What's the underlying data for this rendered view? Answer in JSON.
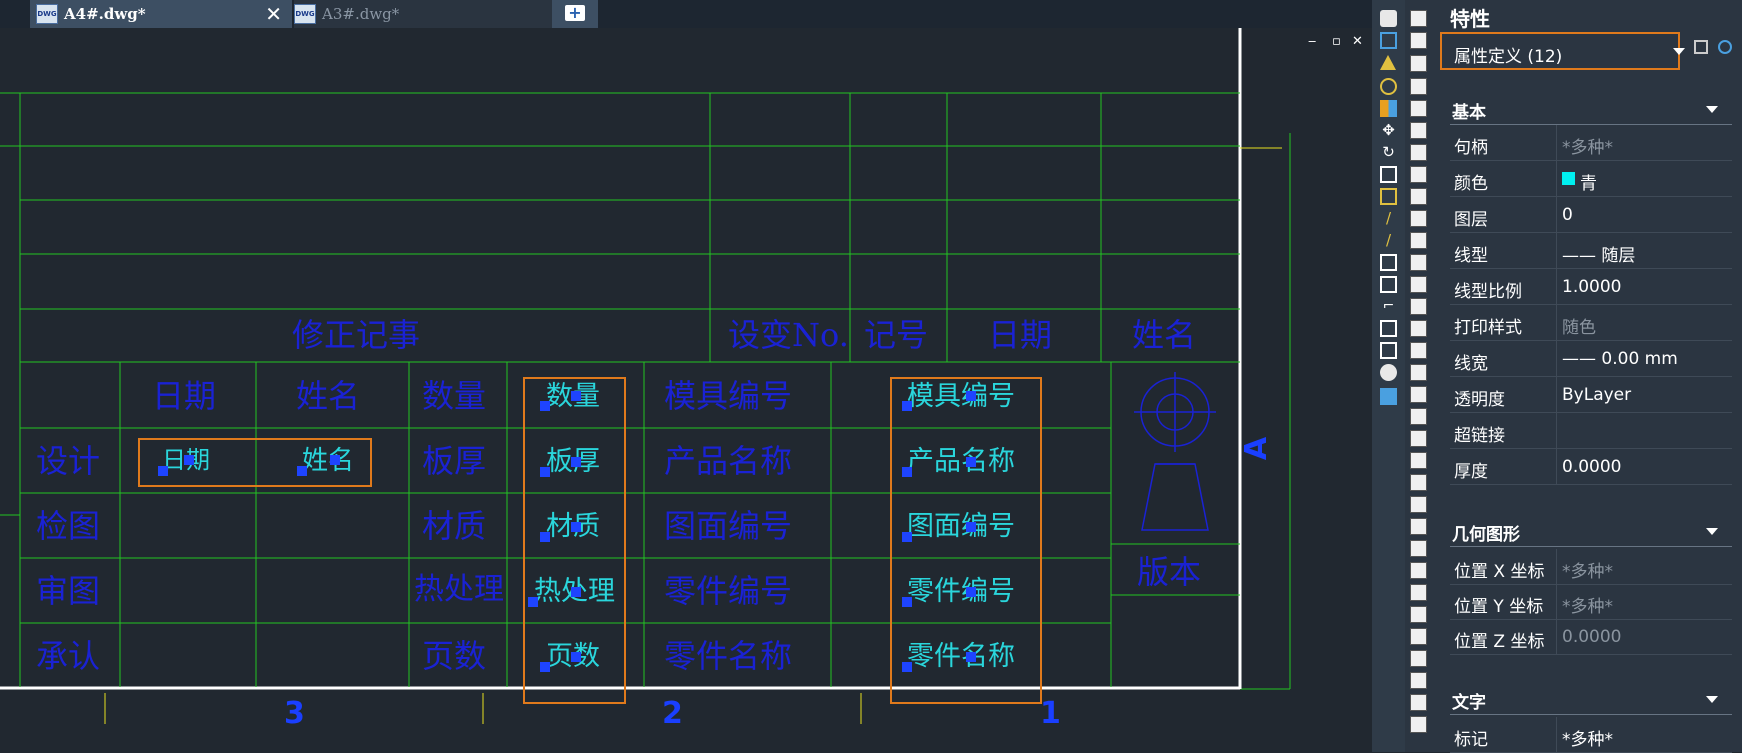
{
  "tabs": [
    {
      "label": "A4#.dwg*",
      "active": true
    },
    {
      "label": "A3#.dwg*",
      "active": false
    }
  ],
  "tab_icon_text": "DWG",
  "new_tab_symbol": "+",
  "window_controls": [
    "‒",
    "▫",
    "✕"
  ],
  "drawing": {
    "revision_row": [
      "修正记事",
      "设变No.",
      "记号",
      "日期",
      "姓名"
    ],
    "table_header": [
      "日期",
      "姓名"
    ],
    "row_labels": [
      "设计",
      "检图",
      "审图",
      "承认"
    ],
    "col3_labels": [
      "数量",
      "板厚",
      "材质",
      "热处理",
      "页数"
    ],
    "col4_attrs": [
      "数量",
      "板厚",
      "材质",
      "热处理",
      "页数"
    ],
    "col5_labels": [
      "模具编号",
      "产品名称",
      "图面编号",
      "零件编号",
      "零件名称"
    ],
    "col6_attrs": [
      "模具编号",
      "产品名称",
      "图面编号",
      "零件编号",
      "零件名称"
    ],
    "design_attrs": [
      "日期",
      "姓名"
    ],
    "version_label": "版本",
    "zone_numbers": [
      "3",
      "2",
      "1"
    ],
    "zone_letter": "A"
  },
  "properties": {
    "title": "特性",
    "selection": "属性定义 (12)",
    "sections": {
      "basic": "基本",
      "geometry": "几何图形",
      "text": "文字"
    },
    "basic_rows": [
      {
        "name": "句柄",
        "value": "*多种*",
        "dim": true
      },
      {
        "name": "颜色",
        "value": "青",
        "dim": false,
        "swatch": "#00f0f0"
      },
      {
        "name": "图层",
        "value": "0",
        "dim": false
      },
      {
        "name": "线型",
        "value": "—— 随层",
        "dim": false
      },
      {
        "name": "线型比例",
        "value": "1.0000",
        "dim": false
      },
      {
        "name": "打印样式",
        "value": "随色",
        "dim": true
      },
      {
        "name": "线宽",
        "value": "—— 0.00 mm",
        "dim": false
      },
      {
        "name": "透明度",
        "value": "ByLayer",
        "dim": false
      },
      {
        "name": "超链接",
        "value": "",
        "dim": false
      },
      {
        "name": "厚度",
        "value": "0.0000",
        "dim": false
      }
    ],
    "geometry_rows": [
      {
        "name": "位置 X 坐标",
        "value": "*多种*",
        "dim": true
      },
      {
        "name": "位置 Y 坐标",
        "value": "*多种*",
        "dim": true
      },
      {
        "name": "位置 Z 坐标",
        "value": "0.0000",
        "dim": true
      }
    ],
    "text_rows": [
      {
        "name": "标记",
        "value": "*多种*",
        "dim": false
      }
    ]
  },
  "colors": {
    "background": "#212830",
    "grid_line": "#22c422",
    "label_text": "#1a22d4",
    "attribute_text": "#2ad6dc",
    "selection_box": "#e07a1c",
    "grip": "#1e44ff"
  }
}
